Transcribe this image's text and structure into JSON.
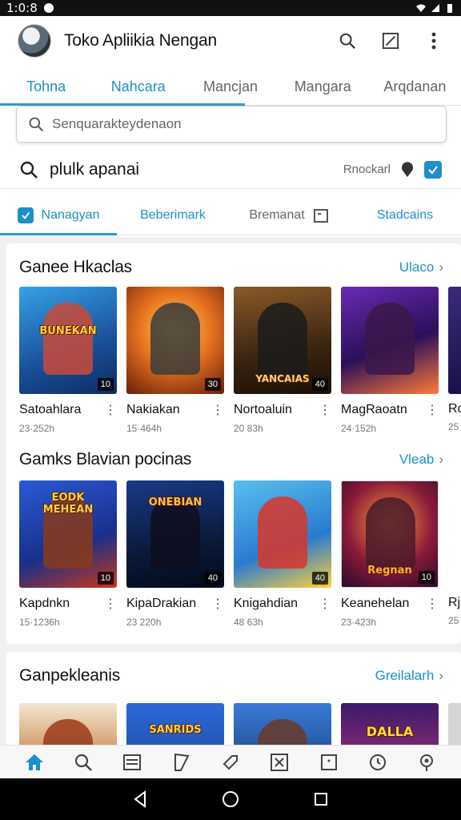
{
  "status_bar": {
    "time": "1:0:8"
  },
  "app_bar": {
    "title": "Toko Apliikia Nengan"
  },
  "top_tabs": [
    "Tohna",
    "Nahcara",
    "Mancjan",
    "Mangara",
    "Arqdanan"
  ],
  "search": {
    "placeholder": "Senquarakteydenaon"
  },
  "query": {
    "text": "plulk apanai",
    "label": "Rnockarl"
  },
  "filter_tabs": [
    "Nanagyan",
    "Beberimark",
    "Bremanat",
    "Stadcains"
  ],
  "sections": [
    {
      "title": "Ganee Hkaclas",
      "link": "Ulaco",
      "items": [
        {
          "name": "Satoahlara",
          "meta": "23·252h",
          "caption": "BUNEKAN",
          "badge": "10"
        },
        {
          "name": "Nakiakan",
          "meta": "15·464h",
          "caption": "",
          "badge": "30"
        },
        {
          "name": "Nortoaluin",
          "meta": "20 83h",
          "caption": "YANCAIAS",
          "badge": "40"
        },
        {
          "name": "MagRaoatn",
          "meta": "24·152h",
          "caption": "",
          "badge": ""
        },
        {
          "name": "Rc",
          "meta": "25",
          "caption": "",
          "badge": ""
        }
      ]
    },
    {
      "title": "Gamks Blavian pocinas",
      "link": "Vleab",
      "items": [
        {
          "name": "Kapdnkn",
          "meta": "15·1236h",
          "caption": "EODK MEHEAN",
          "badge": "10"
        },
        {
          "name": "KipaDrakian",
          "meta": "23 220h",
          "caption": "ONEBIAN",
          "badge": "40"
        },
        {
          "name": "Knigahdian",
          "meta": "48 63h",
          "caption": "",
          "badge": "40"
        },
        {
          "name": "Keanehelan",
          "meta": "23·423h",
          "caption": "Regnan",
          "badge": "10"
        },
        {
          "name": "Rj",
          "meta": "25",
          "caption": "",
          "badge": ""
        }
      ]
    },
    {
      "title": "Ganpekleanis",
      "link": "Greilalarh",
      "items": [
        {
          "caption": ""
        },
        {
          "caption": "SANRIDS"
        },
        {
          "caption": ""
        },
        {
          "caption": "DALLA"
        }
      ]
    }
  ],
  "colors": {
    "accent": "#1e8fc9"
  }
}
